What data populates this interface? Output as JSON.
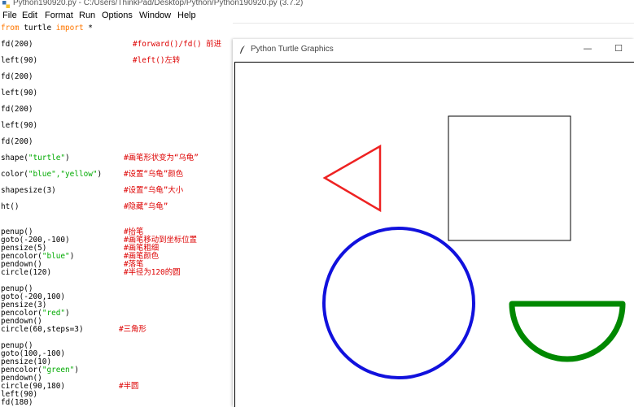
{
  "window": {
    "title": "Python190920.py - C:/Users/ThinkPad/Desktop/Python/Python190920.py (3.7.2)"
  },
  "menu": {
    "file": "File",
    "edit": "Edit",
    "format": "Format",
    "run": "Run",
    "options": "Options",
    "window": "Window",
    "help": "Help"
  },
  "editor": {
    "lines": [
      {
        "a": "from",
        "b": " turtle ",
        "c": "import",
        "d": " *",
        "cm": ""
      },
      {
        "a": "",
        "b": "fd(200)",
        "c": "",
        "d": "",
        "cm": "#forward()/fd() 前进"
      },
      {
        "a": "",
        "b": "left(90)",
        "c": "",
        "d": "",
        "cm": "#left()左转"
      },
      {
        "a": "",
        "b": "fd(200)",
        "c": "",
        "d": "",
        "cm": ""
      },
      {
        "a": "",
        "b": "left(90)",
        "c": "",
        "d": "",
        "cm": ""
      },
      {
        "a": "",
        "b": "fd(200)",
        "c": "",
        "d": "",
        "cm": ""
      },
      {
        "a": "",
        "b": "left(90)",
        "c": "",
        "d": "",
        "cm": ""
      },
      {
        "a": "",
        "b": "fd(200)",
        "c": "",
        "d": "",
        "cm": ""
      },
      {
        "a": "",
        "b": "shape(",
        "c": "\"turtle\"",
        "d": ")",
        "cm": "#画笔形状变为“乌龟”"
      },
      {
        "a": "",
        "b": "color(",
        "c": "\"blue\",\"yellow\"",
        "d": ")",
        "cm": "#设置“乌龟”颜色"
      },
      {
        "a": "",
        "b": "shapesize(3)",
        "c": "",
        "d": "",
        "cm": "#设置“乌龟”大小"
      },
      {
        "a": "",
        "b": "ht()",
        "c": "",
        "d": "",
        "cm": "#隐藏“乌龟”"
      },
      {
        "a": "",
        "b": "penup()",
        "c": "",
        "d": "",
        "cm": "#抬笔"
      },
      {
        "a": "",
        "b": "goto(-200,-100)",
        "c": "",
        "d": "",
        "cm": "#画笔移动到坐标位置"
      },
      {
        "a": "",
        "b": "pensize(5)",
        "c": "",
        "d": "",
        "cm": "#画笔粗细"
      },
      {
        "a": "",
        "b": "pencolor(",
        "c": "\"blue\"",
        "d": ")",
        "cm": "#画笔颜色"
      },
      {
        "a": "",
        "b": "pendown()",
        "c": "",
        "d": "",
        "cm": "#落笔"
      },
      {
        "a": "",
        "b": "circle(120)",
        "c": "",
        "d": "",
        "cm": "#半径为120的圆"
      },
      {
        "a": "",
        "b": "penup()",
        "c": "",
        "d": "",
        "cm": ""
      },
      {
        "a": "",
        "b": "goto(-200,100)",
        "c": "",
        "d": "",
        "cm": ""
      },
      {
        "a": "",
        "b": "pensize(3)",
        "c": "",
        "d": "",
        "cm": ""
      },
      {
        "a": "",
        "b": "pencolor(",
        "c": "\"red\"",
        "d": ")",
        "cm": ""
      },
      {
        "a": "",
        "b": "pendown()",
        "c": "",
        "d": "",
        "cm": ""
      },
      {
        "a": "",
        "b": "circle(60,steps=3)",
        "c": "",
        "d": "",
        "cm": "#三角形"
      },
      {
        "a": "",
        "b": "penup()",
        "c": "",
        "d": "",
        "cm": ""
      },
      {
        "a": "",
        "b": "goto(100,-100)",
        "c": "",
        "d": "",
        "cm": ""
      },
      {
        "a": "",
        "b": "pensize(10)",
        "c": "",
        "d": "",
        "cm": ""
      },
      {
        "a": "",
        "b": "pencolor(",
        "c": "\"green\"",
        "d": ")",
        "cm": ""
      },
      {
        "a": "",
        "b": "pendown()",
        "c": "",
        "d": "",
        "cm": ""
      },
      {
        "a": "",
        "b": "circle(90,180)",
        "c": "",
        "d": "",
        "cm": "#半圆"
      },
      {
        "a": "",
        "b": "left(90)",
        "c": "",
        "d": "",
        "cm": ""
      },
      {
        "a": "",
        "b": "fd(180)",
        "c": "",
        "d": "",
        "cm": ""
      }
    ]
  },
  "turtle_window": {
    "title": "Python Turtle Graphics",
    "minimize_glyph": "—",
    "maximize_glyph": "☐"
  },
  "drawing": {
    "square_color": "#000000",
    "triangle_color": "#ee2222",
    "circle_color": "#1111dd",
    "semicircle_color": "#008800"
  },
  "colors": {
    "keyword": "#ff7700",
    "string": "#00aa00",
    "comment": "#dd0000"
  }
}
